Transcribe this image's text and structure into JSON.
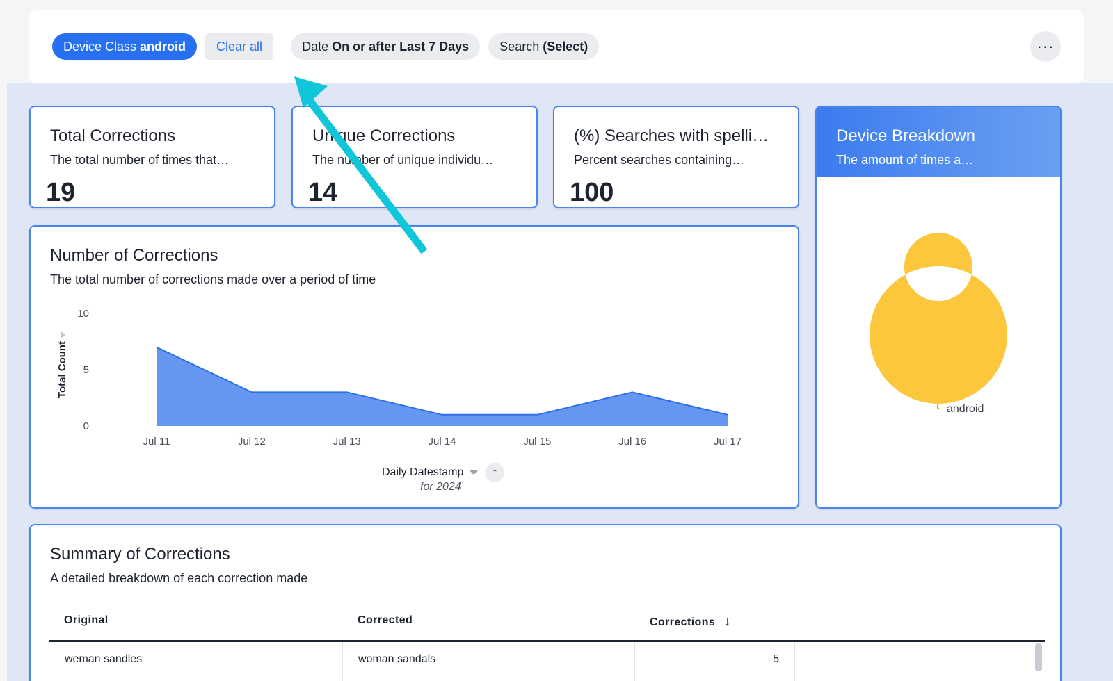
{
  "filters": {
    "device_chip": {
      "label": "Device Class",
      "value": "android"
    },
    "clear_all": "Clear all",
    "date_chip": {
      "label": "Date",
      "value": "On or after Last 7 Days"
    },
    "search_chip": {
      "label": "Search",
      "value": "(Select)"
    },
    "more_label": "···"
  },
  "kpis": [
    {
      "title": "Total Corrections",
      "subtitle": "The total number of times that…",
      "value": "19"
    },
    {
      "title": "Unique Corrections",
      "subtitle": "The number of unique individu…",
      "value": "14"
    },
    {
      "title": "(%) Searches with spelli…",
      "subtitle": "Percent searches containing…",
      "value": "100"
    }
  ],
  "device_breakdown": {
    "title": "Device Breakdown",
    "subtitle": "The amount of times a…"
  },
  "corrections_chart": {
    "title": "Number of Corrections",
    "subtitle": "The total number of corrections made over a period of time",
    "x_axis_label": "Daily Datestamp",
    "x_axis_sub": "for 2024",
    "sort_icon": "↑"
  },
  "summary": {
    "title": "Summary of Corrections",
    "subtitle": "A detailed breakdown of each correction made",
    "columns": [
      "Original",
      "Corrected",
      "Corrections"
    ],
    "sort_icon": "↓",
    "rows": [
      {
        "original": "weman sandles",
        "corrected": "woman sandals",
        "corrections": "5"
      }
    ]
  },
  "colors": {
    "accent": "#2770ef",
    "area_fill": "#6596f2",
    "donut": "#fcc73d",
    "annotation_arrow": "#12c6d9"
  },
  "chart_data": [
    {
      "type": "area",
      "x": [
        "Jul 11",
        "Jul 12",
        "Jul 13",
        "Jul 14",
        "Jul 15",
        "Jul 16",
        "Jul 17"
      ],
      "values": [
        7,
        3,
        3,
        1,
        1,
        3,
        1
      ],
      "xlabel": "Daily Datestamp",
      "ylabel": "Total Count",
      "ylim": [
        0,
        10
      ],
      "yticks": [
        0,
        5,
        10
      ],
      "grid": false
    },
    {
      "type": "pie",
      "donut": true,
      "categories": [
        "android"
      ],
      "values": [
        100
      ],
      "legend": "labels-on-slice"
    }
  ]
}
